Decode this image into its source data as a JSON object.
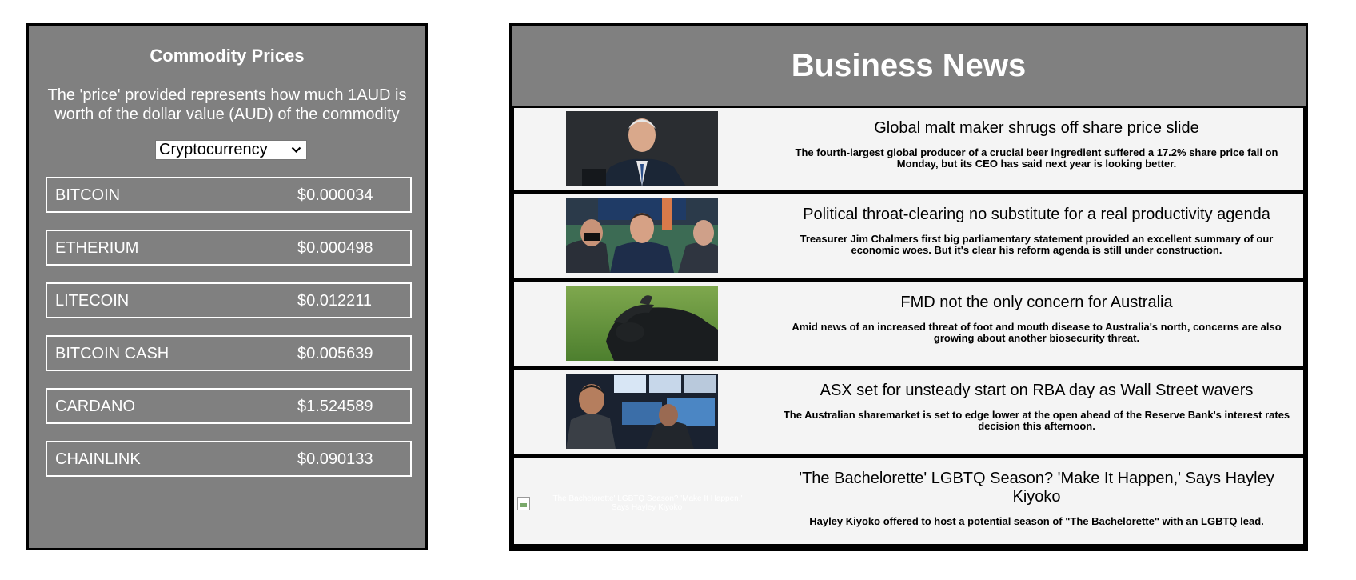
{
  "commodity": {
    "title": "Commodity Prices",
    "description": "The 'price' provided represents how much 1AUD is worth of the dollar value (AUD) of the commodity",
    "select": {
      "selected": "Cryptocurrency"
    },
    "items": [
      {
        "name": "BITCOIN",
        "price": "$0.000034"
      },
      {
        "name": "ETHERIUM",
        "price": "$0.000498"
      },
      {
        "name": "LITECOIN",
        "price": "$0.012211"
      },
      {
        "name": "BITCOIN CASH",
        "price": "$0.005639"
      },
      {
        "name": "CARDANO",
        "price": "$1.524589"
      },
      {
        "name": "CHAINLINK",
        "price": "$0.090133"
      }
    ]
  },
  "news": {
    "title": "Business News",
    "articles": [
      {
        "headline": "Global malt maker shrugs off share price slide",
        "summary": "The fourth-largest global producer of a crucial beer ingredient suffered a 17.2% share price fall on Monday, but its CEO has said next year is looking better.",
        "image": "ceo-portrait"
      },
      {
        "headline": "Political throat-clearing no substitute for a real productivity agenda",
        "summary": "Treasurer Jim Chalmers first big parliamentary statement provided an excellent summary of our economic woes. But it's clear his reform agenda is still under construction.",
        "image": "parliament-photo"
      },
      {
        "headline": "FMD not the only concern for Australia",
        "summary": "Amid news of an increased threat of foot and mouth disease to Australia's north, concerns are also growing about another biosecurity threat.",
        "image": "buffalo-photo"
      },
      {
        "headline": "ASX set for unsteady start on RBA day as Wall Street wavers",
        "summary": "The Australian sharemarket is set to edge lower at the open ahead of the Reserve Bank's interest rates decision this afternoon.",
        "image": "trader-photo"
      },
      {
        "headline": "'The Bachelorette' LGBTQ Season? 'Make It Happen,' Says Hayley Kiyoko",
        "summary": "Hayley Kiyoko offered to host a potential season of \"The Bachelorette\" with an LGBTQ lead.",
        "image_alt": "'The Bachelorette' LGBTQ Season? 'Make It Happen,' Says Hayley Kiyoko"
      }
    ]
  },
  "colors": {
    "panel_bg": "#808080",
    "item_bg": "#f4f4f4",
    "border": "#000000",
    "text_light": "#ffffff"
  }
}
